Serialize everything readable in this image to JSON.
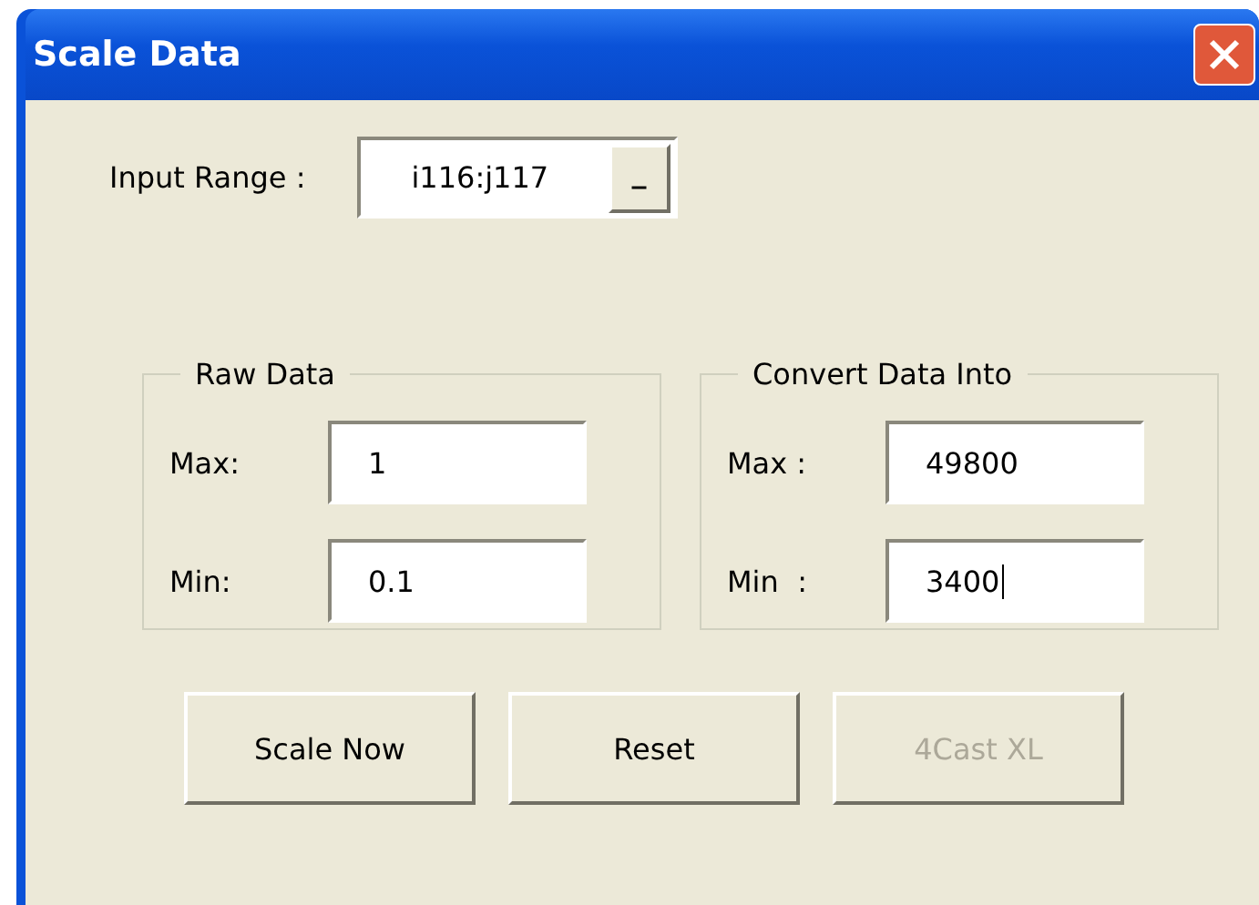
{
  "window": {
    "title": "Scale Data"
  },
  "input_range": {
    "label": "Input Range :",
    "value": "i116:j117",
    "picker_button": "_"
  },
  "groups": [
    {
      "title": "Raw Data",
      "fields": [
        {
          "label": "Max:",
          "value": "1",
          "focused": false
        },
        {
          "label": "Min:",
          "value": "0.1",
          "focused": false
        }
      ]
    },
    {
      "title": "Convert Data Into",
      "fields": [
        {
          "label": "Max :",
          "value": "49800",
          "focused": false
        },
        {
          "label": "Min  :",
          "value": "3400",
          "focused": true
        }
      ]
    }
  ],
  "buttons": [
    {
      "label": "Scale Now",
      "disabled": false
    },
    {
      "label": "Reset",
      "disabled": false
    },
    {
      "label": "4Cast XL",
      "disabled": true
    }
  ]
}
